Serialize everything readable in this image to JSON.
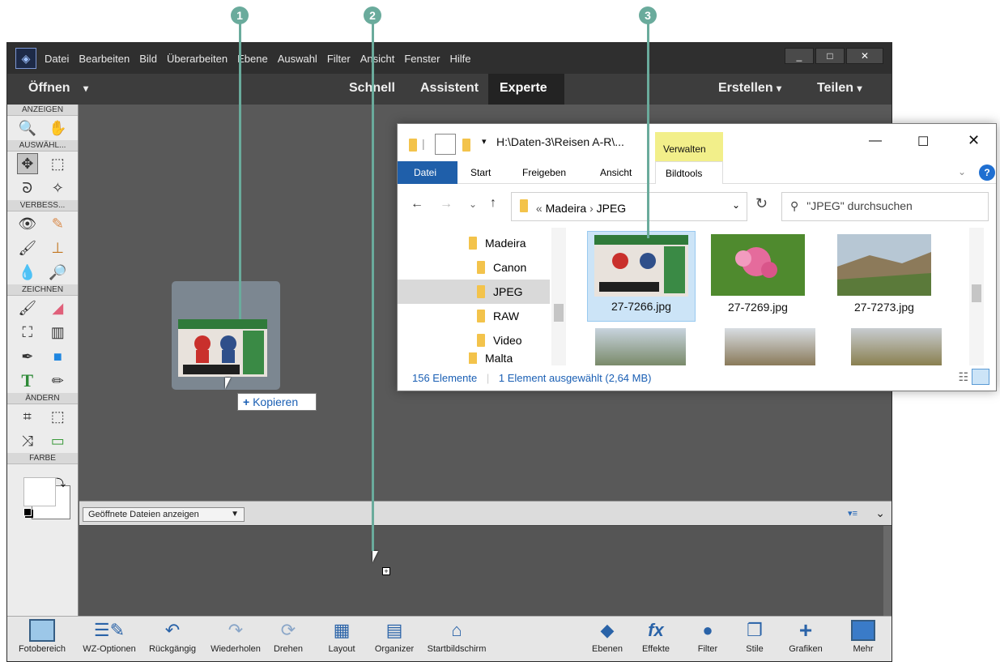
{
  "menubar": {
    "items": [
      "Datei",
      "Bearbeiten",
      "Bild",
      "Überarbeiten",
      "Ebene",
      "Auswahl",
      "Filter",
      "Ansicht",
      "Fenster",
      "Hilfe"
    ],
    "win_minimize": "_",
    "win_maximize": "□",
    "win_close": "✕"
  },
  "topbar": {
    "open": "Öffnen",
    "quick": "Schnell",
    "guided": "Assistent",
    "expert": "Experte",
    "create": "Erstellen",
    "share": "Teilen"
  },
  "toolbox": {
    "sections": {
      "view": "ANZEIGEN",
      "select": "AUSWÄHL...",
      "enhance": "VERBESS...",
      "draw": "ZEICHNEN",
      "modify": "ÄNDERN",
      "color": "FARBE"
    }
  },
  "filesbar": {
    "dropdown": "Geöffnete Dateien anzeigen"
  },
  "drag": {
    "copy_label": "Kopieren",
    "plus": "+"
  },
  "bottombar": {
    "items": [
      {
        "label": "Fotobereich"
      },
      {
        "label": "WZ-Optionen"
      },
      {
        "label": "Rückgängig"
      },
      {
        "label": "Wiederholen"
      },
      {
        "label": "Drehen"
      },
      {
        "label": "Layout"
      },
      {
        "label": "Organizer"
      },
      {
        "label": "Startbildschirm"
      },
      {
        "label": "Ebenen"
      },
      {
        "label": "Effekte"
      },
      {
        "label": "Filter"
      },
      {
        "label": "Stile"
      },
      {
        "label": "Grafiken"
      },
      {
        "label": "Mehr"
      }
    ]
  },
  "explorer": {
    "path_title": "H:\\Daten-3\\Reisen A-R\\...",
    "manage_tab": "Verwalten",
    "ribbon": {
      "file": "Datei",
      "start": "Start",
      "share": "Freigeben",
      "view": "Ansicht",
      "picture_tools": "Bildtools"
    },
    "address": {
      "prefix": "«",
      "folder": "Madeira",
      "sep": "›",
      "current": "JPEG"
    },
    "search_placeholder": "\"JPEG\" durchsuchen",
    "tree": [
      "Madeira",
      "Canon",
      "JPEG",
      "RAW",
      "Video",
      "Malta"
    ],
    "files": [
      "27-7266.jpg",
      "27-7269.jpg",
      "27-7273.jpg"
    ],
    "status": {
      "count": "156 Elemente",
      "selected": "1 Element ausgewählt (2,64 MB)"
    }
  },
  "callouts": [
    "1",
    "2",
    "3"
  ]
}
